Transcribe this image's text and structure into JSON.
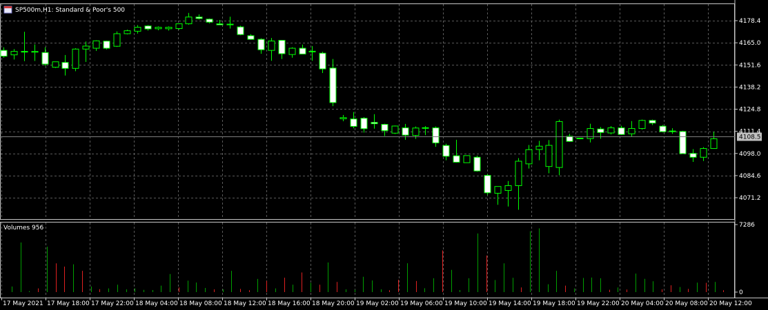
{
  "window": {
    "symbol": "SP500m,H1:  Standard & Poor's 500",
    "volume_label": "Volumes 956"
  },
  "colors": {
    "background": "#000000",
    "grid": "#5a5a5a",
    "frame": "#c8c8c8",
    "bull_body": "#000000",
    "bear_body": "#ffffff",
    "candle_outline": "#00ff00",
    "volume_up": "#00a000",
    "volume_down": "#e02020",
    "price_line": "#808080",
    "price_tag_bg": "#c0c0c0",
    "price_tag_text": "#000000"
  },
  "chart_data": [
    {
      "type": "candlestick",
      "name": "price",
      "y_ticks": [
        "4178.4",
        "4165.0",
        "4151.6",
        "4138.2",
        "4124.8",
        "4111.4",
        "4098.0",
        "4084.6",
        "4071.2"
      ],
      "ylim": [
        4061.3,
        4184.3
      ],
      "current_price": "4108.5",
      "candles": [
        {
          "o": 4160.4,
          "h": 4162.3,
          "l": 4156.0,
          "c": 4156.9
        },
        {
          "o": 4157.7,
          "h": 4161.2,
          "l": 4154.9,
          "c": 4159.8
        },
        {
          "o": 4159.8,
          "h": 4171.7,
          "l": 4153.9,
          "c": 4159.8
        },
        {
          "o": 4159.3,
          "h": 4164.0,
          "l": 4154.0,
          "c": 4159.8
        },
        {
          "o": 4159.1,
          "h": 4162.3,
          "l": 4151.0,
          "c": 4152.1
        },
        {
          "o": 4150.2,
          "h": 4153.5,
          "l": 4149.8,
          "c": 4153.5
        },
        {
          "o": 4153.1,
          "h": 4157.6,
          "l": 4145.2,
          "c": 4149.5
        },
        {
          "o": 4149.5,
          "h": 4161.7,
          "l": 4147.8,
          "c": 4161.2
        },
        {
          "o": 4161.2,
          "h": 4165.8,
          "l": 4153.4,
          "c": 4163.0
        },
        {
          "o": 4161.7,
          "h": 4166.5,
          "l": 4160.1,
          "c": 4166.2
        },
        {
          "o": 4166.0,
          "h": 4166.3,
          "l": 4161.0,
          "c": 4161.7
        },
        {
          "o": 4162.9,
          "h": 4171.9,
          "l": 4162.5,
          "c": 4170.5
        },
        {
          "o": 4170.5,
          "h": 4173.0,
          "l": 4170.1,
          "c": 4172.3
        },
        {
          "o": 4172.0,
          "h": 4175.7,
          "l": 4170.6,
          "c": 4174.4
        },
        {
          "o": 4175.2,
          "h": 4175.7,
          "l": 4172.4,
          "c": 4173.4
        },
        {
          "o": 4173.5,
          "h": 4174.9,
          "l": 4172.6,
          "c": 4174.4
        },
        {
          "o": 4173.5,
          "h": 4174.9,
          "l": 4172.4,
          "c": 4174.4
        },
        {
          "o": 4173.6,
          "h": 4176.7,
          "l": 4173.0,
          "c": 4176.5
        },
        {
          "o": 4176.5,
          "h": 4183.1,
          "l": 4176.0,
          "c": 4180.6
        },
        {
          "o": 4180.6,
          "h": 4182.2,
          "l": 4179.2,
          "c": 4179.7
        },
        {
          "o": 4179.3,
          "h": 4179.7,
          "l": 4176.8,
          "c": 4177.5
        },
        {
          "o": 4176.5,
          "h": 4178.8,
          "l": 4175.8,
          "c": 4175.9
        },
        {
          "o": 4176.3,
          "h": 4180.8,
          "l": 4173.6,
          "c": 4176.3
        },
        {
          "o": 4174.6,
          "h": 4175.3,
          "l": 4169.6,
          "c": 4170.0
        },
        {
          "o": 4169.3,
          "h": 4170.2,
          "l": 4166.9,
          "c": 4167.1
        },
        {
          "o": 4167.1,
          "h": 4167.7,
          "l": 4158.4,
          "c": 4160.8
        },
        {
          "o": 4160.4,
          "h": 4167.9,
          "l": 4154.1,
          "c": 4166.1
        },
        {
          "o": 4166.5,
          "h": 4166.7,
          "l": 4155.2,
          "c": 4158.4
        },
        {
          "o": 4157.9,
          "h": 4162.3,
          "l": 4156.0,
          "c": 4161.7
        },
        {
          "o": 4161.7,
          "h": 4163.9,
          "l": 4158.4,
          "c": 4158.2
        },
        {
          "o": 4159.6,
          "h": 4163.0,
          "l": 4154.1,
          "c": 4159.9
        },
        {
          "o": 4158.7,
          "h": 4159.6,
          "l": 4146.7,
          "c": 4149.2
        },
        {
          "o": 4149.7,
          "h": 4155.2,
          "l": 4126.6,
          "c": 4128.8
        },
        {
          "o": 4119.0,
          "h": 4121.3,
          "l": 4117.5,
          "c": 4119.7
        },
        {
          "o": 4118.9,
          "h": 4123.1,
          "l": 4113.2,
          "c": 4114.4
        },
        {
          "o": 4119.3,
          "h": 4120.0,
          "l": 4110.6,
          "c": 4113.0
        },
        {
          "o": 4116.8,
          "h": 4121.8,
          "l": 4113.0,
          "c": 4116.0
        },
        {
          "o": 4115.6,
          "h": 4116.0,
          "l": 4108.6,
          "c": 4111.8
        },
        {
          "o": 4110.3,
          "h": 4114.9,
          "l": 4109.8,
          "c": 4114.6
        },
        {
          "o": 4113.5,
          "h": 4115.9,
          "l": 4106.3,
          "c": 4109.1
        },
        {
          "o": 4108.9,
          "h": 4114.3,
          "l": 4106.8,
          "c": 4113.4
        },
        {
          "o": 4113.6,
          "h": 4114.6,
          "l": 4109.1,
          "c": 4113.5
        },
        {
          "o": 4113.5,
          "h": 4114.3,
          "l": 4102.0,
          "c": 4104.4
        },
        {
          "o": 4102.8,
          "h": 4103.9,
          "l": 4093.9,
          "c": 4096.3
        },
        {
          "o": 4096.6,
          "h": 4106.3,
          "l": 4092.4,
          "c": 4092.7
        },
        {
          "o": 4092.4,
          "h": 4095.6,
          "l": 4092.4,
          "c": 4096.7
        },
        {
          "o": 4095.7,
          "h": 4096.7,
          "l": 4087.0,
          "c": 4087.4
        },
        {
          "o": 4084.7,
          "h": 4085.5,
          "l": 4072.9,
          "c": 4074.2
        },
        {
          "o": 4073.9,
          "h": 4078.0,
          "l": 4066.9,
          "c": 4078.0
        },
        {
          "o": 4075.6,
          "h": 4081.3,
          "l": 4065.9,
          "c": 4078.5
        },
        {
          "o": 4078.5,
          "h": 4095.2,
          "l": 4063.9,
          "c": 4093.3
        },
        {
          "o": 4091.7,
          "h": 4103.1,
          "l": 4088.9,
          "c": 4100.3
        },
        {
          "o": 4100.4,
          "h": 4105.6,
          "l": 4093.9,
          "c": 4102.4
        },
        {
          "o": 4090.1,
          "h": 4106.1,
          "l": 4086.0,
          "c": 4102.9
        },
        {
          "o": 4089.5,
          "h": 4118.5,
          "l": 4084.8,
          "c": 4117.3
        },
        {
          "o": 4108.4,
          "h": 4109.9,
          "l": 4105.0,
          "c": 4105.3
        },
        {
          "o": 4107.1,
          "h": 4107.3,
          "l": 4106.6,
          "c": 4107.3
        },
        {
          "o": 4107.0,
          "h": 4116.0,
          "l": 4104.7,
          "c": 4113.1
        },
        {
          "o": 4112.8,
          "h": 4114.0,
          "l": 4106.9,
          "c": 4110.7
        },
        {
          "o": 4110.4,
          "h": 4114.6,
          "l": 4109.5,
          "c": 4113.5
        },
        {
          "o": 4113.5,
          "h": 4114.8,
          "l": 4109.2,
          "c": 4109.5
        },
        {
          "o": 4109.9,
          "h": 4117.6,
          "l": 4108.0,
          "c": 4113.1
        },
        {
          "o": 4113.1,
          "h": 4118.5,
          "l": 4112.5,
          "c": 4118.0
        },
        {
          "o": 4118.0,
          "h": 4118.5,
          "l": 4115.2,
          "c": 4116.4
        },
        {
          "o": 4114.5,
          "h": 4115.2,
          "l": 4110.8,
          "c": 4111.2
        },
        {
          "o": 4111.6,
          "h": 4113.3,
          "l": 4109.9,
          "c": 4111.5
        },
        {
          "o": 4111.3,
          "h": 4111.7,
          "l": 4099.1,
          "c": 4097.9
        },
        {
          "o": 4098.0,
          "h": 4100.6,
          "l": 4092.9,
          "c": 4095.7
        },
        {
          "o": 4095.7,
          "h": 4101.8,
          "l": 4093.4,
          "c": 4101.0
        },
        {
          "o": 4101.0,
          "h": 4111.1,
          "l": 4101.0,
          "c": 4106.9
        }
      ]
    },
    {
      "type": "bar",
      "name": "volume",
      "y_ticks": [
        "7286",
        "0"
      ],
      "ylim": [
        0,
        7286
      ],
      "values": [
        600,
        5350,
        100,
        400,
        4900,
        3100,
        2750,
        3000,
        2300,
        600,
        320,
        400,
        800,
        300,
        400,
        240,
        220,
        700,
        1950,
        500,
        1240,
        1030,
        450,
        300,
        300,
        2300,
        340,
        200,
        1420,
        1200,
        400,
        1550,
        800,
        2120,
        1000,
        800,
        3200,
        1100,
        300,
        250,
        1650,
        1250,
        300,
        200,
        1330,
        3110,
        1200,
        420,
        1500,
        4500,
        2400,
        220,
        1500,
        6330,
        3950,
        1300,
        3100,
        1540,
        500,
        6570,
        6880,
        850,
        2300,
        700,
        400,
        1520,
        1570,
        1500,
        250,
        500,
        280,
        2000,
        1430,
        1170,
        300,
        730,
        550,
        340,
        1020,
        1000,
        1100,
        200
      ],
      "up": [
        1,
        1,
        1,
        0,
        1,
        0,
        0,
        1,
        0,
        1,
        0,
        1,
        1,
        1,
        1,
        1,
        1,
        1,
        1,
        0,
        1,
        1,
        1,
        0,
        1,
        1,
        0,
        0,
        1,
        0,
        1,
        0,
        1,
        0,
        1,
        0,
        1,
        0,
        1,
        1,
        1,
        1,
        1,
        0,
        0,
        1,
        0,
        1,
        1,
        0,
        1,
        1,
        1,
        1,
        0,
        1,
        1,
        1,
        0,
        1,
        1,
        1,
        1,
        0,
        1,
        1,
        1,
        1,
        0,
        1,
        0,
        1,
        1,
        1,
        0,
        0,
        1,
        0,
        1,
        0,
        1,
        0
      ]
    }
  ],
  "x_axis_labels": [
    "17 May 2021",
    "17 May 18:00",
    "17 May 22:00",
    "18 May 04:00",
    "18 May 08:00",
    "18 May 12:00",
    "18 May 16:00",
    "18 May 20:00",
    "19 May 02:00",
    "19 May 06:00",
    "19 May 10:00",
    "19 May 14:00",
    "19 May 18:00",
    "19 May 22:00",
    "20 May 04:00",
    "20 May 08:00",
    "20 May 12:00"
  ]
}
